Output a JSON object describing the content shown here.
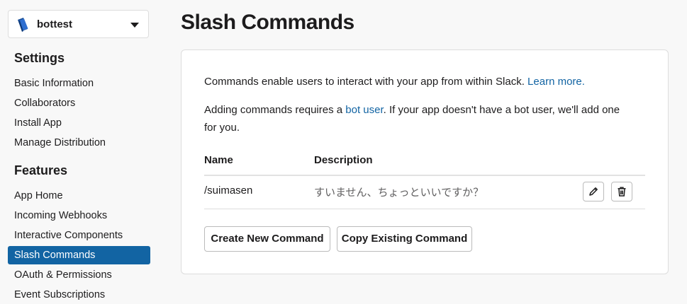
{
  "app_selector": {
    "name": "bottest",
    "icon": "book-icon"
  },
  "sidebar": {
    "settings_title": "Settings",
    "settings_items": [
      {
        "label": "Basic Information"
      },
      {
        "label": "Collaborators"
      },
      {
        "label": "Install App"
      },
      {
        "label": "Manage Distribution"
      }
    ],
    "features_title": "Features",
    "features_items": [
      {
        "label": "App Home"
      },
      {
        "label": "Incoming Webhooks"
      },
      {
        "label": "Interactive Components"
      },
      {
        "label": "Slash Commands",
        "active": true
      },
      {
        "label": "OAuth & Permissions"
      },
      {
        "label": "Event Subscriptions"
      }
    ]
  },
  "main": {
    "title": "Slash Commands",
    "intro_text": "Commands enable users to interact with your app from within Slack.",
    "learn_more_link": "Learn more.",
    "bot_text_1": "Adding commands requires a",
    "bot_user_link": "bot user",
    "bot_text_2": ". If your app doesn't have a bot user, we'll add one",
    "bot_text_3": "for you.",
    "table": {
      "headers": {
        "name": "Name",
        "description": "Description"
      },
      "rows": [
        {
          "name": "/suimasen",
          "description": "すいません、ちょっといいですか？"
        }
      ]
    },
    "buttons": {
      "create": "Create New Command",
      "copy": "Copy Existing Command"
    }
  },
  "colors": {
    "accent": "#1264a3",
    "link": "#1264a3",
    "background": "#f8f8f8"
  }
}
